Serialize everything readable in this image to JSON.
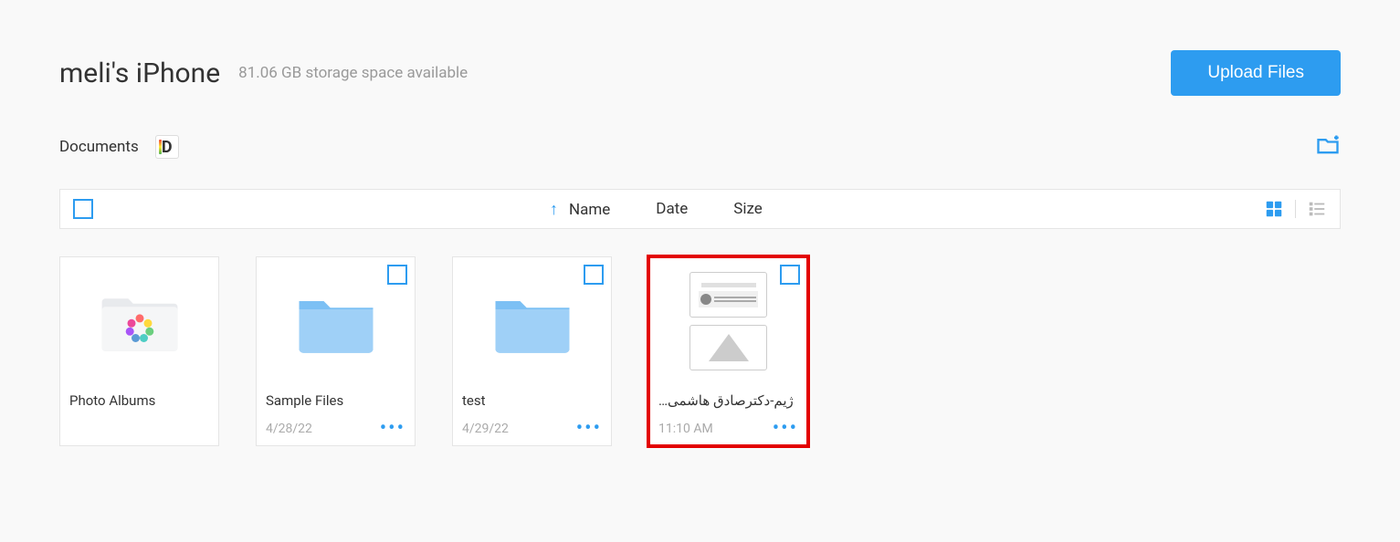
{
  "header": {
    "device_title": "meli's iPhone",
    "storage_text": "81.06 GB storage space available",
    "upload_label": "Upload Files"
  },
  "breadcrumb": {
    "label": "Documents"
  },
  "toolbar": {
    "sort_columns": [
      "Name",
      "Date",
      "Size"
    ]
  },
  "items": [
    {
      "name": "Photo Albums",
      "date": "",
      "type": "photo-folder",
      "show_checkbox": false,
      "show_footer": false,
      "highlighted": false
    },
    {
      "name": "Sample Files",
      "date": "4/28/22",
      "type": "folder",
      "show_checkbox": true,
      "show_footer": true,
      "highlighted": false
    },
    {
      "name": "test",
      "date": "4/29/22",
      "type": "folder",
      "show_checkbox": true,
      "show_footer": true,
      "highlighted": false
    },
    {
      "name": "…ژیم-دکترصادق هاشمی",
      "date": "11:10 AM",
      "type": "document",
      "show_checkbox": true,
      "show_footer": true,
      "highlighted": true
    }
  ]
}
